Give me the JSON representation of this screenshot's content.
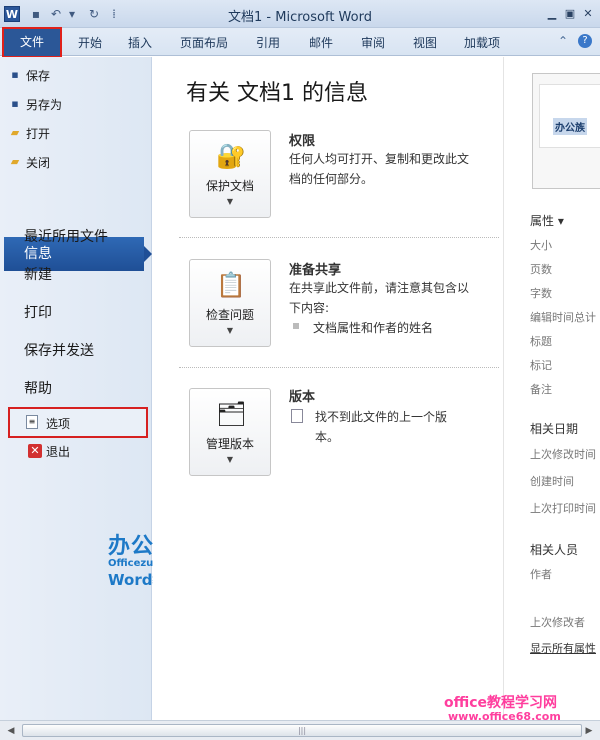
{
  "window": {
    "title": "文档1 - Microsoft Word",
    "app_icon": "W",
    "controls": [
      "minimize-icon",
      "restore-icon",
      "close-icon"
    ]
  },
  "ribbon": {
    "file_tab": "文件",
    "tabs": [
      "开始",
      "插入",
      "页面布局",
      "引用",
      "邮件",
      "审阅",
      "视图",
      "加载项"
    ],
    "right_icons": [
      "collapse-ribbon-icon",
      "help-icon"
    ]
  },
  "sidebar": {
    "top_items": [
      {
        "label": "保存",
        "icon": "save-icon"
      },
      {
        "label": "另存为",
        "icon": "save-as-icon"
      },
      {
        "label": "打开",
        "icon": "open-folder-icon"
      },
      {
        "label": "关闭",
        "icon": "close-folder-icon"
      }
    ],
    "selected": "信息",
    "big_items": [
      "最近所用文件",
      "新建",
      "打印",
      "保存并发送",
      "帮助"
    ],
    "bottom_items": [
      {
        "label": "选项",
        "icon": "options-icon"
      },
      {
        "label": "退出",
        "icon": "exit-icon"
      }
    ],
    "logo": {
      "main": "办公族",
      "url": "Officezu.com",
      "sub": "Word教程"
    }
  },
  "main": {
    "title": "有关 文档1 的信息",
    "sections": [
      {
        "button": "保护文档",
        "icon": "lock-key-icon",
        "title": "权限",
        "desc": "任何人均可打开、复制和更改此文档的任何部分。"
      },
      {
        "button": "检查问题",
        "icon": "inspect-checklist-icon",
        "title": "准备共享",
        "desc": "在共享此文件前，请注意其包含以下内容:",
        "bullet": "文档属性和作者的姓名"
      },
      {
        "button": "管理版本",
        "icon": "versions-magnifier-icon",
        "title": "版本",
        "desc": "找不到此文件的上一个版本。"
      }
    ]
  },
  "properties": {
    "thumb_text": "办公族",
    "header": "属性 ▾",
    "fields": [
      "大小",
      "页数",
      "字数",
      "编辑时间总计",
      "标题",
      "标记",
      "备注"
    ],
    "dates_header": "相关日期",
    "date_fields": [
      "上次修改时间",
      "创建时间",
      "上次打印时间"
    ],
    "people_header": "相关人员",
    "people_fields": [
      "作者",
      "上次修改者"
    ],
    "show_all": "显示所有属性"
  },
  "watermark": {
    "line1": "office教程学习网",
    "line2": "www.office68.com"
  },
  "colors": {
    "file_tab": "#2b5797",
    "selected": "#1f4f96",
    "highlight_box": "#d62020",
    "logo": "#1d79c7",
    "watermark": "#ff3e9e"
  }
}
